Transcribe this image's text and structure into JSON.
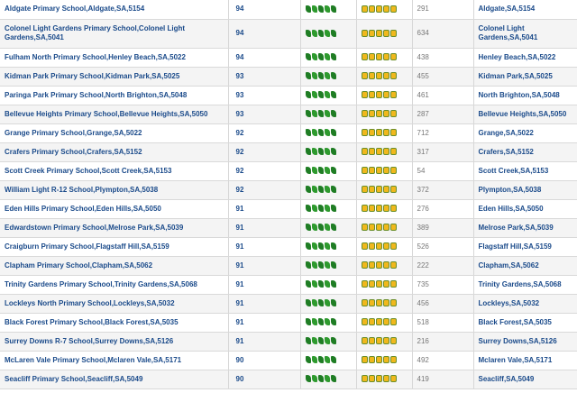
{
  "rows": [
    {
      "name": "Aldgate Primary School,Aldgate,SA,5154",
      "score": "94",
      "count": "291",
      "loc": "Aldgate,SA,5154"
    },
    {
      "name": "Colonel Light Gardens Primary School,Colonel Light Gardens,SA,5041",
      "score": "94",
      "count": "634",
      "loc": "Colonel Light Gardens,SA,5041"
    },
    {
      "name": "Fulham North Primary School,Henley Beach,SA,5022",
      "score": "94",
      "count": "438",
      "loc": "Henley Beach,SA,5022"
    },
    {
      "name": "Kidman Park Primary School,Kidman Park,SA,5025",
      "score": "93",
      "count": "455",
      "loc": "Kidman Park,SA,5025"
    },
    {
      "name": "Paringa Park Primary School,North Brighton,SA,5048",
      "score": "93",
      "count": "461",
      "loc": "North Brighton,SA,5048"
    },
    {
      "name": "Bellevue Heights Primary School,Bellevue Heights,SA,5050",
      "score": "93",
      "count": "287",
      "loc": "Bellevue Heights,SA,5050"
    },
    {
      "name": "Grange Primary School,Grange,SA,5022",
      "score": "92",
      "count": "712",
      "loc": "Grange,SA,5022"
    },
    {
      "name": "Crafers Primary School,Crafers,SA,5152",
      "score": "92",
      "count": "317",
      "loc": "Crafers,SA,5152"
    },
    {
      "name": "Scott Creek Primary School,Scott Creek,SA,5153",
      "score": "92",
      "count": "54",
      "loc": "Scott Creek,SA,5153"
    },
    {
      "name": "William Light R-12 School,Plympton,SA,5038",
      "score": "92",
      "count": "372",
      "loc": "Plympton,SA,5038"
    },
    {
      "name": "Eden Hills Primary School,Eden Hills,SA,5050",
      "score": "91",
      "count": "276",
      "loc": "Eden Hills,SA,5050"
    },
    {
      "name": "Edwardstown Primary School,Melrose Park,SA,5039",
      "score": "91",
      "count": "389",
      "loc": "Melrose Park,SA,5039"
    },
    {
      "name": "Craigburn Primary School,Flagstaff Hill,SA,5159",
      "score": "91",
      "count": "526",
      "loc": "Flagstaff Hill,SA,5159"
    },
    {
      "name": "Clapham Primary School,Clapham,SA,5062",
      "score": "91",
      "count": "222",
      "loc": "Clapham,SA,5062"
    },
    {
      "name": "Trinity Gardens Primary School,Trinity Gardens,SA,5068",
      "score": "91",
      "count": "735",
      "loc": "Trinity Gardens,SA,5068"
    },
    {
      "name": "Lockleys North Primary School,Lockleys,SA,5032",
      "score": "91",
      "count": "456",
      "loc": "Lockleys,SA,5032"
    },
    {
      "name": "Black Forest Primary School,Black Forest,SA,5035",
      "score": "91",
      "count": "518",
      "loc": "Black Forest,SA,5035"
    },
    {
      "name": "Surrey Downs R-7 School,Surrey Downs,SA,5126",
      "score": "91",
      "count": "216",
      "loc": "Surrey Downs,SA,5126"
    },
    {
      "name": "McLaren Vale Primary School,Mclaren Vale,SA,5171",
      "score": "90",
      "count": "492",
      "loc": "Mclaren Vale,SA,5171"
    },
    {
      "name": "Seacliff Primary School,Seacliff,SA,5049",
      "score": "90",
      "count": "419",
      "loc": "Seacliff,SA,5049"
    }
  ],
  "green_rating": 5,
  "face_rating": 5,
  "colors": {
    "link": "#1a4a8a",
    "leaf": "#2e9a2e",
    "face": "#f0b81c"
  }
}
